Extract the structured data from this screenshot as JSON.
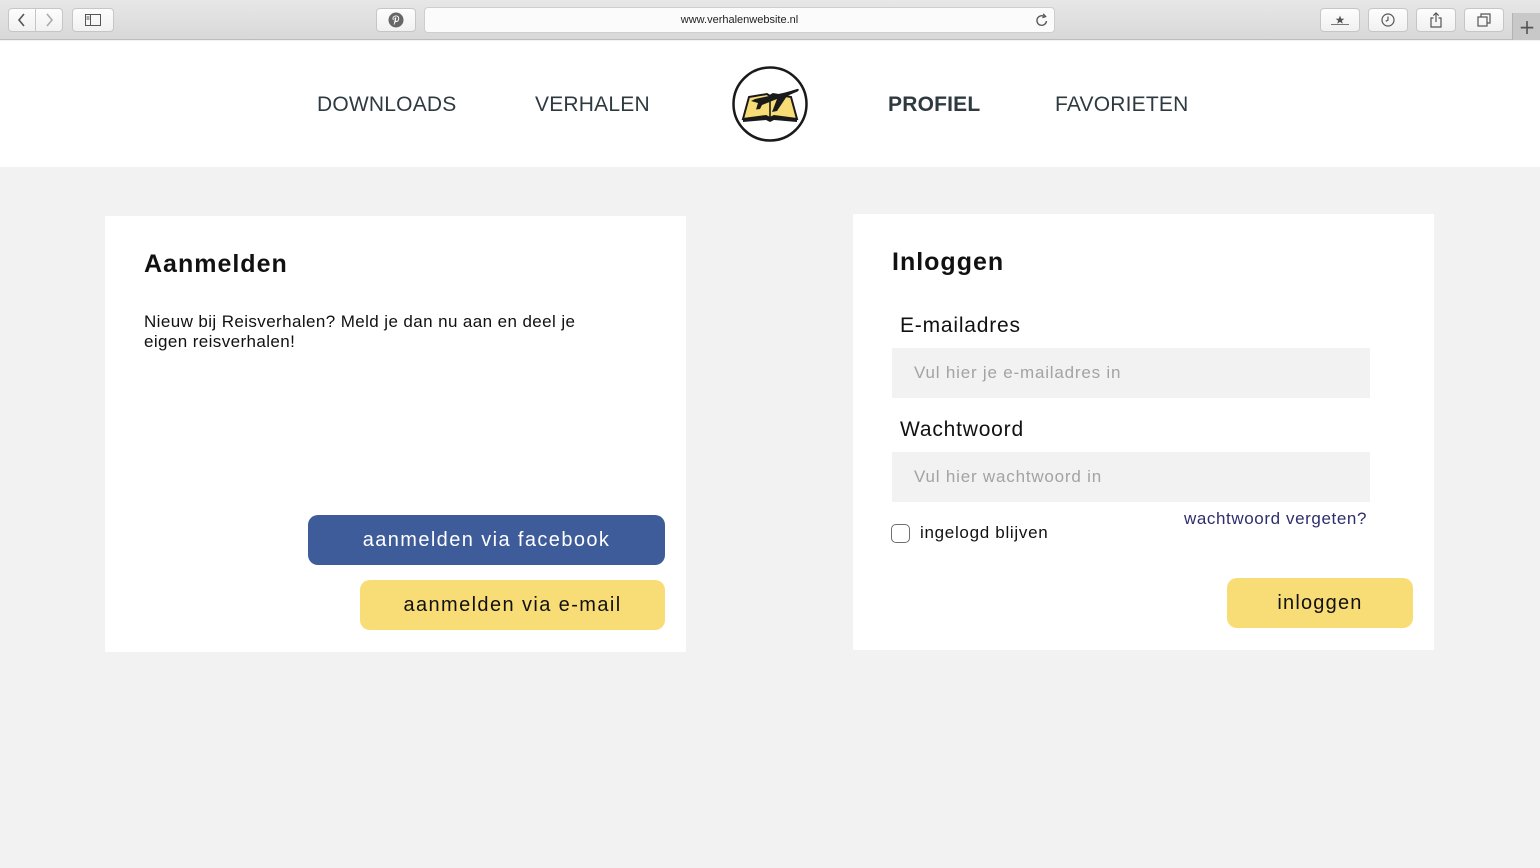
{
  "browser": {
    "url": "www.verhalenwebsite.nl",
    "new_tab_label": "+"
  },
  "nav": {
    "downloads": "DOWNLOADS",
    "verhalen": "VERHALEN",
    "profiel": "PROFIEL",
    "favorieten": "FAVORIETEN",
    "active": "PROFIEL"
  },
  "signup": {
    "title": "Aanmelden",
    "text": "Nieuw bij Reisverhalen? Meld je dan nu aan en deel je eigen reisverhalen!",
    "facebook_button": "aanmelden via facebook",
    "email_button": "aanmelden via e-mail"
  },
  "login": {
    "title": "Inloggen",
    "email_label": "E-mailadres",
    "email_placeholder": "Vul hier je e-mailadres in",
    "email_value": "",
    "password_label": "Wachtwoord",
    "password_placeholder": "Vul hier wachtwoord in",
    "password_value": "",
    "forgot_link": "wachtwoord vergeten?",
    "remember_label": "ingelogd blijven",
    "remember_checked": false,
    "login_button": "inloggen"
  },
  "colors": {
    "facebook": "#3e5b9a",
    "accent_yellow": "#f8dd76",
    "page_background": "#f3f2f2",
    "link": "#2f2d6e"
  }
}
